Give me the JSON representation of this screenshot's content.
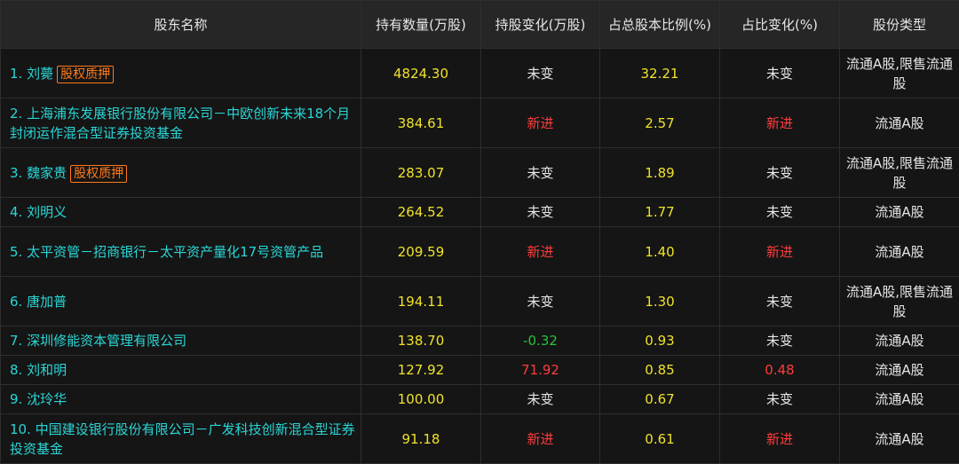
{
  "headers": [
    "股东名称",
    "持有数量(万股)",
    "持股变化(万股)",
    "占总股本比例(%)",
    "占比变化(%)",
    "股份类型"
  ],
  "pledge_label": "股权质押",
  "rows": [
    {
      "name": "1. 刘薨",
      "pledge": true,
      "qty": "4824.30",
      "qty_change": "未变",
      "qty_change_kind": "same",
      "ratio": "32.21",
      "ratio_change": "未变",
      "ratio_change_kind": "same",
      "type": "流通A股,限售流通股"
    },
    {
      "name": "2. 上海浦东发展银行股份有限公司－中欧创新未来18个月封闭运作混合型证券投资基金",
      "pledge": false,
      "qty": "384.61",
      "qty_change": "新进",
      "qty_change_kind": "new",
      "ratio": "2.57",
      "ratio_change": "新进",
      "ratio_change_kind": "new",
      "type": "流通A股"
    },
    {
      "name": "3. 魏家贵",
      "pledge": true,
      "qty": "283.07",
      "qty_change": "未变",
      "qty_change_kind": "same",
      "ratio": "1.89",
      "ratio_change": "未变",
      "ratio_change_kind": "same",
      "type": "流通A股,限售流通股"
    },
    {
      "name": "4. 刘明义",
      "pledge": false,
      "qty": "264.52",
      "qty_change": "未变",
      "qty_change_kind": "same",
      "ratio": "1.77",
      "ratio_change": "未变",
      "ratio_change_kind": "same",
      "type": "流通A股"
    },
    {
      "name": "5. 太平资管－招商银行－太平资产量化17号资管产品",
      "pledge": false,
      "qty": "209.59",
      "qty_change": "新进",
      "qty_change_kind": "new",
      "ratio": "1.40",
      "ratio_change": "新进",
      "ratio_change_kind": "new",
      "type": "流通A股"
    },
    {
      "name": "6. 唐加普",
      "pledge": false,
      "qty": "194.11",
      "qty_change": "未变",
      "qty_change_kind": "same",
      "ratio": "1.30",
      "ratio_change": "未变",
      "ratio_change_kind": "same",
      "type": "流通A股,限售流通股"
    },
    {
      "name": "7. 深圳修能资本管理有限公司",
      "pledge": false,
      "qty": "138.70",
      "qty_change": "-0.32",
      "qty_change_kind": "down",
      "ratio": "0.93",
      "ratio_change": "未变",
      "ratio_change_kind": "same",
      "type": "流通A股"
    },
    {
      "name": "8. 刘和明",
      "pledge": false,
      "qty": "127.92",
      "qty_change": "71.92",
      "qty_change_kind": "up",
      "ratio": "0.85",
      "ratio_change": "0.48",
      "ratio_change_kind": "up",
      "type": "流通A股"
    },
    {
      "name": "9. 沈玲华",
      "pledge": false,
      "qty": "100.00",
      "qty_change": "未变",
      "qty_change_kind": "same",
      "ratio": "0.67",
      "ratio_change": "未变",
      "ratio_change_kind": "same",
      "type": "流通A股"
    },
    {
      "name": "10. 中国建设银行股份有限公司－广发科技创新混合型证券投资基金",
      "pledge": false,
      "qty": "91.18",
      "qty_change": "新进",
      "qty_change_kind": "new",
      "ratio": "0.61",
      "ratio_change": "新进",
      "ratio_change_kind": "new",
      "type": "流通A股"
    }
  ],
  "colors": {
    "background": "#141414",
    "header_background": "#262626",
    "name_text": "#2ad6d6",
    "number_text": "#f0e22a",
    "new_or_increase": "#ff3c3c",
    "decrease": "#27c23a",
    "pledge_badge": "#ff7a1a"
  }
}
